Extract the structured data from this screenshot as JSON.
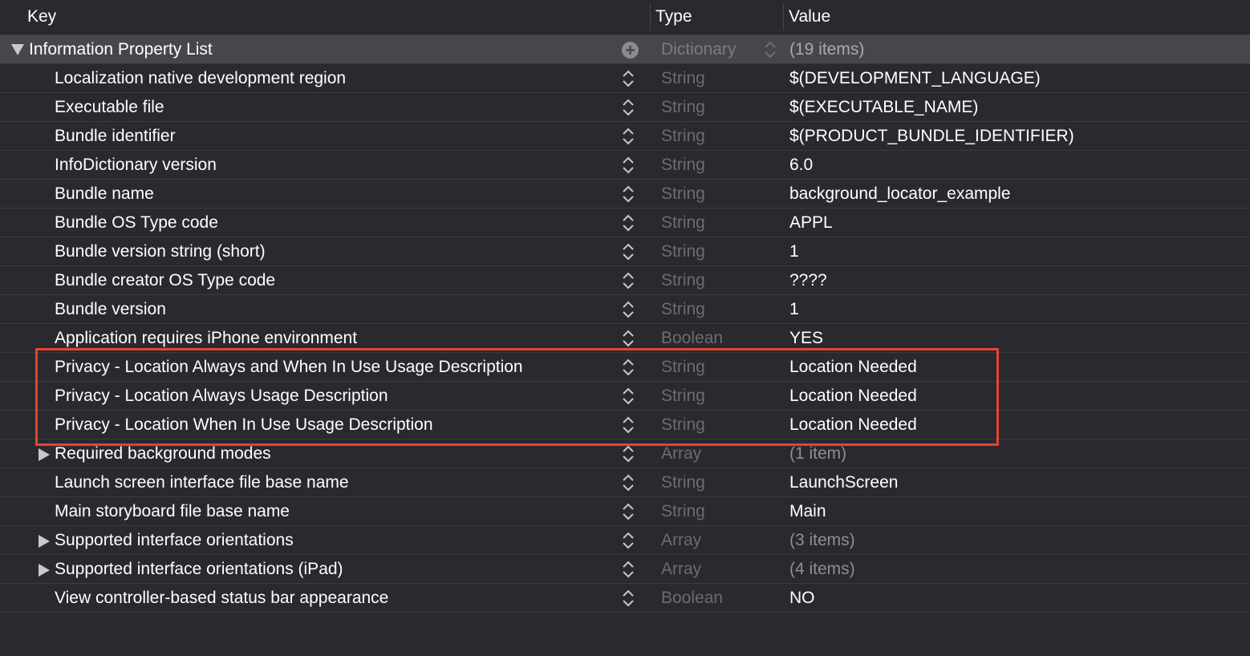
{
  "columns": {
    "key": "Key",
    "type": "Type",
    "value": "Value"
  },
  "root": {
    "key": "Information Property List",
    "type": "Dictionary",
    "value": "(19 items)"
  },
  "rows": [
    {
      "key": "Localization native development region",
      "type": "String",
      "value": "$(DEVELOPMENT_LANGUAGE)",
      "expandable": false
    },
    {
      "key": "Executable file",
      "type": "String",
      "value": "$(EXECUTABLE_NAME)",
      "expandable": false
    },
    {
      "key": "Bundle identifier",
      "type": "String",
      "value": "$(PRODUCT_BUNDLE_IDENTIFIER)",
      "expandable": false
    },
    {
      "key": "InfoDictionary version",
      "type": "String",
      "value": "6.0",
      "expandable": false
    },
    {
      "key": "Bundle name",
      "type": "String",
      "value": "background_locator_example",
      "expandable": false
    },
    {
      "key": "Bundle OS Type code",
      "type": "String",
      "value": "APPL",
      "expandable": false
    },
    {
      "key": "Bundle version string (short)",
      "type": "String",
      "value": "1",
      "expandable": false
    },
    {
      "key": "Bundle creator OS Type code",
      "type": "String",
      "value": "????",
      "expandable": false
    },
    {
      "key": "Bundle version",
      "type": "String",
      "value": "1",
      "expandable": false
    },
    {
      "key": "Application requires iPhone environment",
      "type": "Boolean",
      "value": "YES",
      "expandable": false
    },
    {
      "key": "Privacy - Location Always and When In Use Usage Description",
      "type": "String",
      "value": "Location Needed",
      "expandable": false
    },
    {
      "key": "Privacy - Location Always Usage Description",
      "type": "String",
      "value": "Location Needed",
      "expandable": false
    },
    {
      "key": "Privacy - Location When In Use Usage Description",
      "type": "String",
      "value": "Location Needed",
      "expandable": false
    },
    {
      "key": "Required background modes",
      "type": "Array",
      "value": "(1 item)",
      "expandable": true
    },
    {
      "key": "Launch screen interface file base name",
      "type": "String",
      "value": "LaunchScreen",
      "expandable": false
    },
    {
      "key": "Main storyboard file base name",
      "type": "String",
      "value": "Main",
      "expandable": false
    },
    {
      "key": "Supported interface orientations",
      "type": "Array",
      "value": "(3 items)",
      "expandable": true
    },
    {
      "key": "Supported interface orientations (iPad)",
      "type": "Array",
      "value": "(4 items)",
      "expandable": true
    },
    {
      "key": "View controller-based status bar appearance",
      "type": "Boolean",
      "value": "NO",
      "expandable": false
    }
  ],
  "icons": {
    "disclosure_open": "triangle-down-icon",
    "disclosure_closed": "triangle-right-icon",
    "add": "plus-circle-icon",
    "type_stepper": "up-down-chevron-icon"
  },
  "colors": {
    "background": "#292a30",
    "root_row": "#46474c",
    "highlight_border": "#e8422f",
    "type_text": "#6b6c72"
  }
}
